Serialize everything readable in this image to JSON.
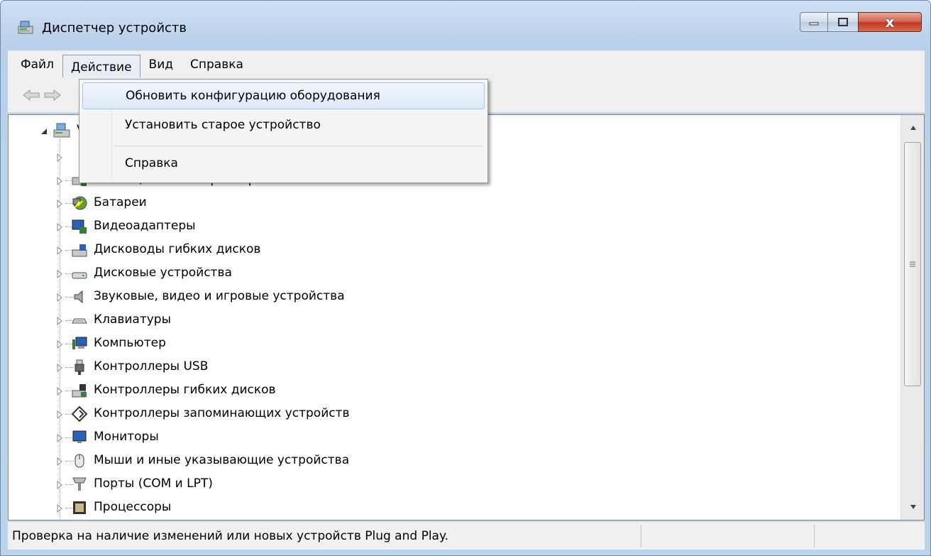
{
  "window": {
    "title": "Диспетчер устройств",
    "close_glyph": "x"
  },
  "menubar": {
    "items": [
      "Файл",
      "Действие",
      "Вид",
      "Справка"
    ]
  },
  "dropdown": {
    "items": [
      "Обновить конфигурацию оборудования",
      "Установить старое устройство",
      "Справка"
    ]
  },
  "tree": {
    "root_label_partial": "V",
    "row1_partial": "",
    "row2_partial": "IDE ATA/ATAPI контроллеры",
    "items": [
      {
        "label": "Батареи",
        "icon": "battery-icon"
      },
      {
        "label": "Видеоадаптеры",
        "icon": "display-adapter-icon"
      },
      {
        "label": "Дисководы гибких дисков",
        "icon": "floppy-drive-icon"
      },
      {
        "label": "Дисковые устройства",
        "icon": "disk-drive-icon"
      },
      {
        "label": "Звуковые, видео и игровые устройства",
        "icon": "speaker-icon"
      },
      {
        "label": "Клавиатуры",
        "icon": "keyboard-icon"
      },
      {
        "label": "Компьютер",
        "icon": "computer-icon"
      },
      {
        "label": "Контроллеры USB",
        "icon": "usb-icon"
      },
      {
        "label": "Контроллеры гибких дисков",
        "icon": "floppy-controller-icon"
      },
      {
        "label": "Контроллеры запоминающих устройств",
        "icon": "storage-controller-icon"
      },
      {
        "label": "Мониторы",
        "icon": "monitor-icon"
      },
      {
        "label": "Мыши и иные указывающие устройства",
        "icon": "mouse-icon"
      },
      {
        "label": "Порты (COM и LPT)",
        "icon": "port-icon"
      },
      {
        "label": "Процессоры",
        "icon": "processor-icon"
      }
    ]
  },
  "statusbar": {
    "text": "Проверка на наличие изменений или новых устройств Plug and Play."
  }
}
